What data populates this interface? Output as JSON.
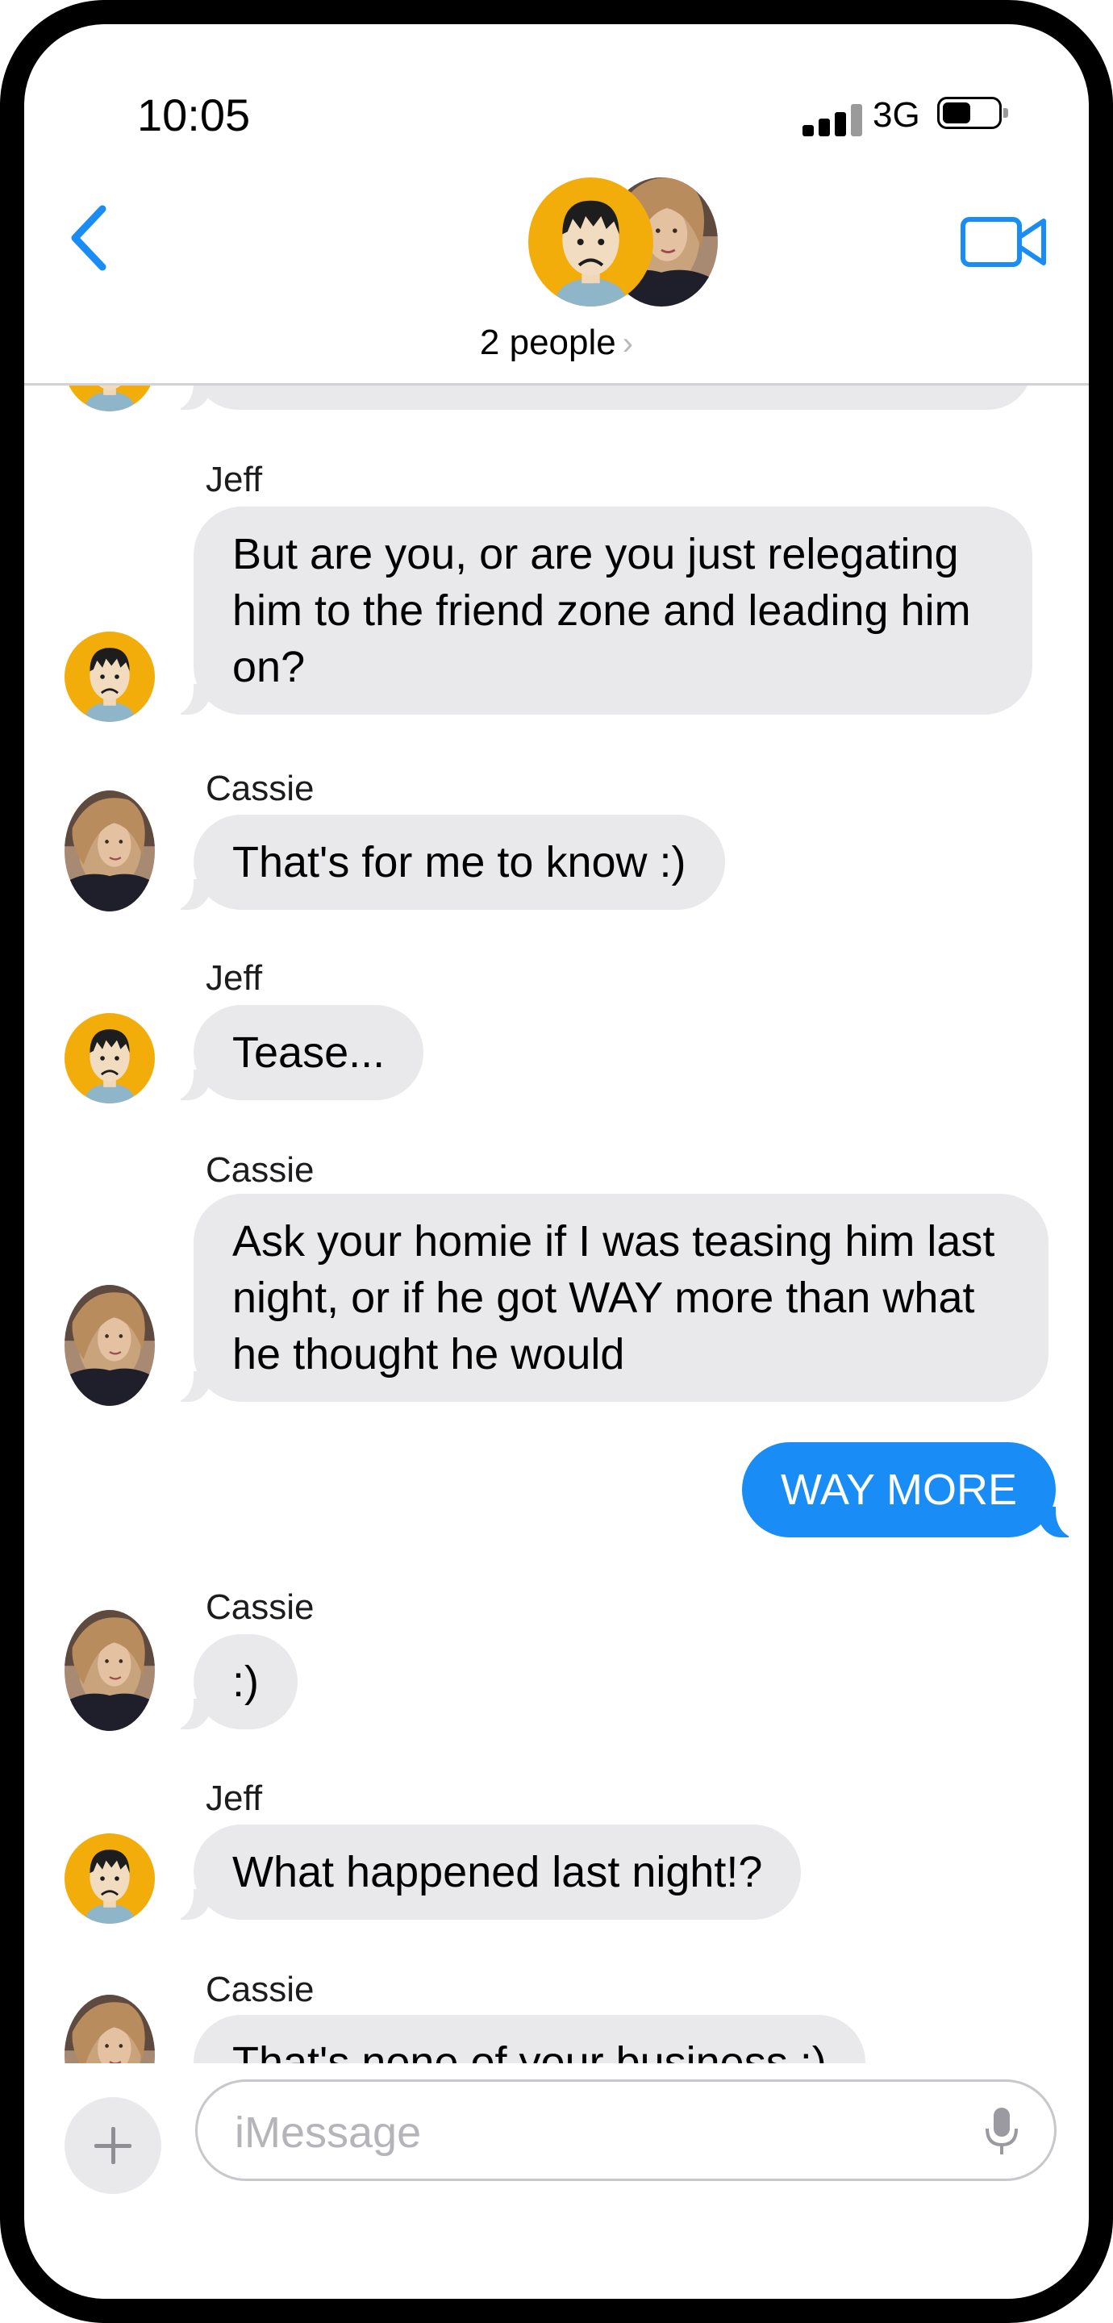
{
  "status_bar": {
    "time": "10:05",
    "network": "3G",
    "signal_icon": "signal-bars-icon",
    "battery_icon": "battery-icon"
  },
  "header": {
    "back_icon": "chevron-left-icon",
    "video_icon": "video-camera-icon",
    "participants_label": "2 people",
    "participants_chevron": "›"
  },
  "messages": [
    {
      "sender": "Jeff",
      "direction": "incoming",
      "text": "But are you, or are you just relegating him to the friend zone and leading him on?"
    },
    {
      "sender": "Cassie",
      "direction": "incoming",
      "text": "That's for me to know :)"
    },
    {
      "sender": "Jeff",
      "direction": "incoming",
      "text": "Tease..."
    },
    {
      "sender": "Cassie",
      "direction": "incoming",
      "text": "Ask your homie if I was teasing him last night, or if he got WAY more than what he thought he would"
    },
    {
      "sender": "",
      "direction": "outgoing",
      "text": "WAY MORE"
    },
    {
      "sender": "Cassie",
      "direction": "incoming",
      "text": ":)"
    },
    {
      "sender": "Jeff",
      "direction": "incoming",
      "text": "What happened last night!?"
    },
    {
      "sender": "Cassie",
      "direction": "incoming",
      "text": "That's none of your business ;)"
    }
  ],
  "composer": {
    "placeholder": "iMessage",
    "add_icon": "plus-icon",
    "mic_icon": "microphone-icon"
  },
  "colors": {
    "accent": "#1a8cf5",
    "incoming_bubble": "#e9e9eb",
    "jeff_avatar": "#f2ad0b"
  }
}
